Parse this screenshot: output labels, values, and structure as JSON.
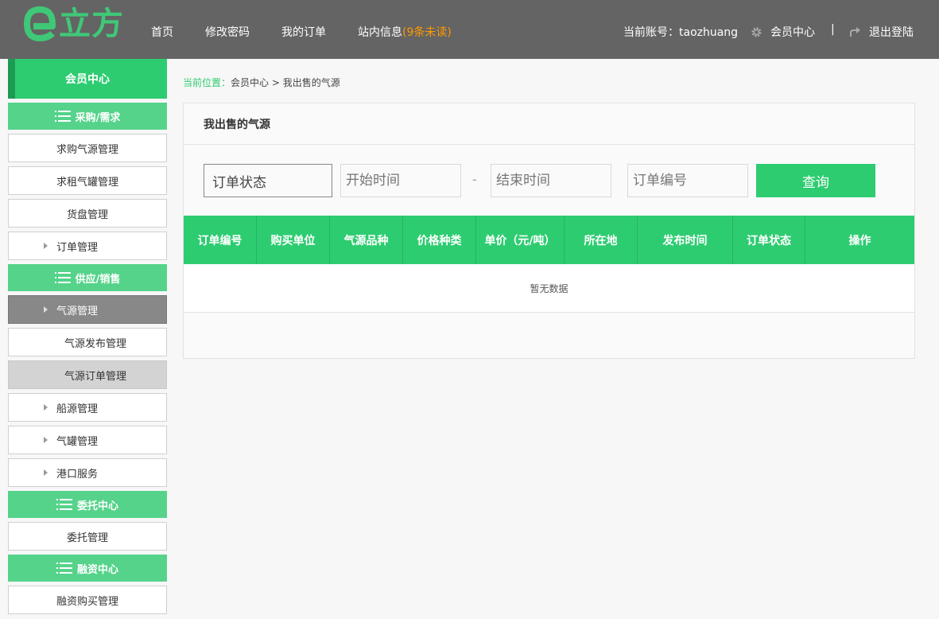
{
  "header": {
    "logo_text": "立方",
    "nav": [
      {
        "label": "首页"
      },
      {
        "label": "修改密码"
      },
      {
        "label": "我的订单"
      },
      {
        "label": "站内信息",
        "badge": "(9条未读)"
      }
    ],
    "account_label": "当前账号：taozhuang",
    "member_center": "会员中心",
    "separator": "|",
    "logout": "退出登陆"
  },
  "sidebar": {
    "title": "会员中心",
    "sections": [
      {
        "label": "采购/需求",
        "items": [
          {
            "label": "求购气源管理"
          },
          {
            "label": "求租气罐管理"
          },
          {
            "label": "货盘管理"
          },
          {
            "label": "订单管理"
          }
        ]
      },
      {
        "label": "供应/销售",
        "items": [
          {
            "label": "气源管理"
          },
          {
            "label": "气源发布管理"
          },
          {
            "label": "气源订单管理"
          },
          {
            "label": "船源管理"
          },
          {
            "label": "气罐管理"
          },
          {
            "label": "港口服务"
          }
        ]
      },
      {
        "label": "委托中心",
        "items": [
          {
            "label": "委托管理"
          }
        ]
      },
      {
        "label": "融资中心",
        "items": [
          {
            "label": "融资购买管理"
          }
        ]
      }
    ]
  },
  "breadcrumb": {
    "lead": "当前位置：",
    "path": "会员中心 > 我出售的气源"
  },
  "panel": {
    "title": "我出售的气源",
    "filters": {
      "status_value": "订单状态",
      "start_placeholder": "开始时间",
      "dash": "-",
      "end_placeholder": "结束时间",
      "order_no_placeholder": "订单编号",
      "query_button": "查询"
    },
    "table": {
      "columns": [
        "订单编号",
        "购买单位",
        "气源品种",
        "价格种类",
        "单价（元/吨）",
        "所在地",
        "发布时间",
        "订单状态",
        "操作"
      ],
      "empty_text": "暂无数据"
    }
  },
  "colors": {
    "accent": "#2ecc71",
    "header_bg": "#646464",
    "unread": "#ff9900"
  }
}
